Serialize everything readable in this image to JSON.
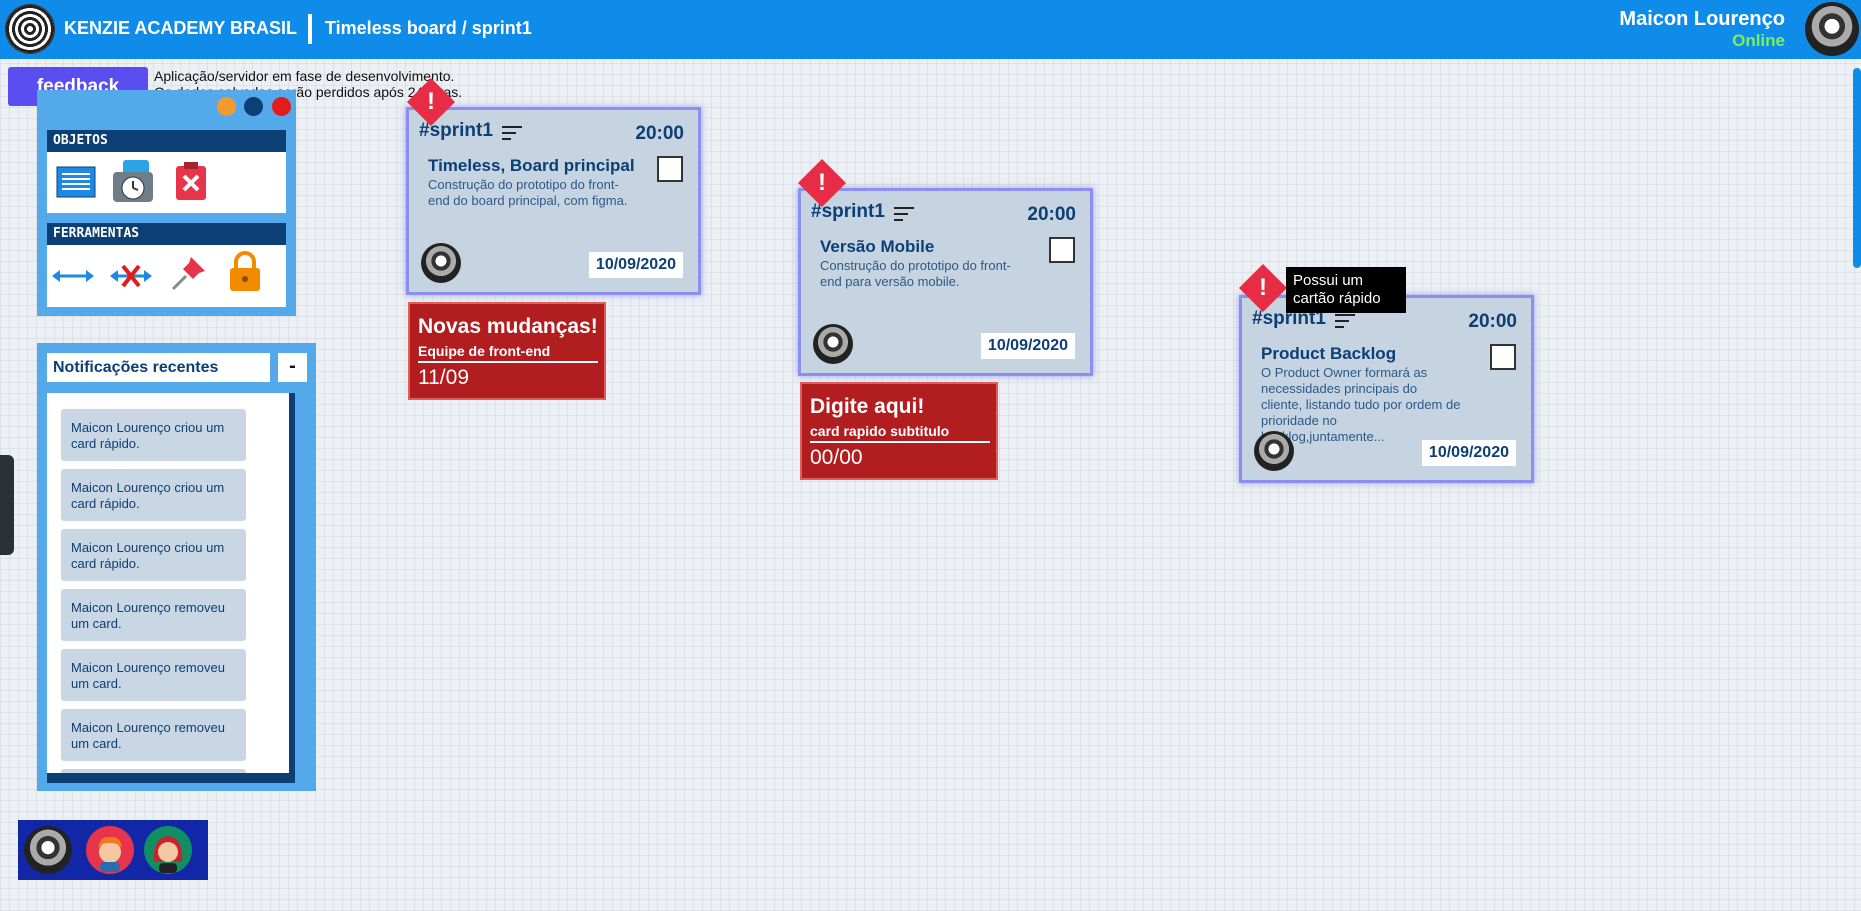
{
  "header": {
    "brand": "KENZIE ACADEMY BRASIL",
    "breadcrumb": "Timeless board / sprint1",
    "user_name": "Maicon Lourenço",
    "user_status": "Online",
    "colors": {
      "header": "#0f8bea",
      "online": "#7cf05a"
    }
  },
  "feedback": {
    "label": "feedback",
    "note_line1": "Aplicação/servidor em fase de desenvolvimento.",
    "note_line2": "Os dados salvados serão perdidos após 24horas."
  },
  "tools": {
    "objects_title": "OBJETOS",
    "objects_icons": [
      "card-list-icon",
      "clock-card-icon",
      "delete-card-icon"
    ],
    "tools_title": "FERRAMENTAS",
    "tools_icons": [
      "connect-arrow-icon",
      "disconnect-arrow-icon",
      "pin-icon",
      "lock-icon"
    ],
    "window_dots": [
      "#f29a2e",
      "#0c3f73",
      "#e21b1b"
    ]
  },
  "notifications": {
    "title": "Notificações recentes",
    "minimize_label": "-",
    "items": [
      "Maicon Lourenço criou um card rápido.",
      "Maicon Lourenço criou um card rápido.",
      "Maicon Lourenço criou um card rápido.",
      "Maicon Lourenço removeu um card.",
      "Maicon Lourenço removeu um card.",
      "Maicon Lourenço removeu um card."
    ]
  },
  "members": [
    "member-avatar-robot",
    "member-avatar-orange-hair",
    "member-avatar-red-hair"
  ],
  "cards": [
    {
      "tag": "#sprint1",
      "time": "20:00",
      "title": "Timeless, Board principal",
      "description": "Construção do prototipo do front-end do board principal, com figma.",
      "date": "10/09/2020",
      "alert": "!"
    },
    {
      "tag": "#sprint1",
      "time": "20:00",
      "title": "Versão Mobile",
      "description": "Construção do prototipo do front-end para versão mobile.",
      "date": "10/09/2020",
      "alert": "!"
    },
    {
      "tag": "#sprint1",
      "time": "20:00",
      "title": "Product Backlog",
      "description": "O Product Owner formará as necessidades principais do cliente, listando tudo por ordem de prioridade no backlog,juntamente...",
      "date": "10/09/2020",
      "alert": "!"
    }
  ],
  "quick_cards": [
    {
      "title": "Novas mudanças!",
      "subtitle": "Equipe de front-end",
      "date": "11/09"
    },
    {
      "title": "Digite aqui!",
      "subtitle": "card rapido subtitulo",
      "date": "00/00"
    }
  ],
  "tooltip": "Possui um cartão rápido"
}
